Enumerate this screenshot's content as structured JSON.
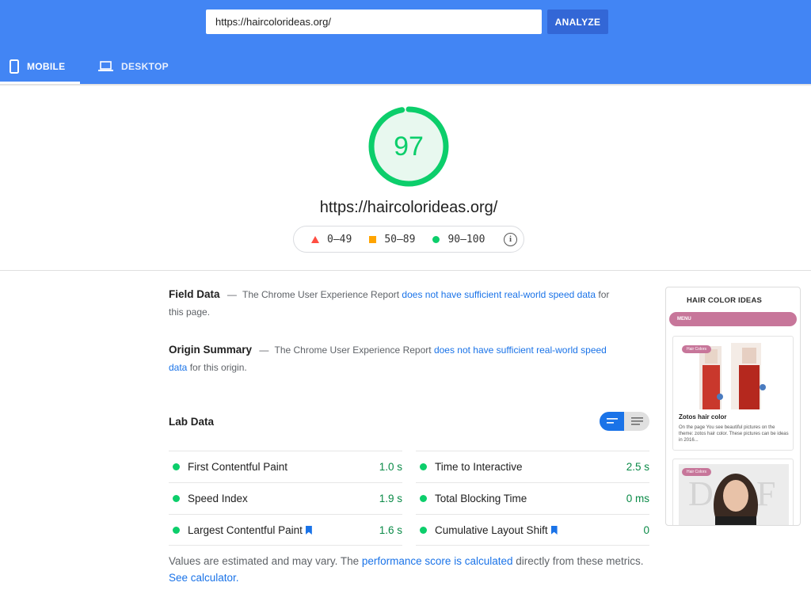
{
  "header": {
    "url_value": "https://haircolorideas.org/",
    "analyze_label": "ANALYZE",
    "tabs": [
      {
        "label": "MOBILE",
        "icon": "phone-icon",
        "selected": true
      },
      {
        "label": "DESKTOP",
        "icon": "laptop-icon",
        "selected": false
      }
    ],
    "colors": {
      "brand": "#4285f4",
      "button": "#3367d6"
    }
  },
  "summary": {
    "score": "97",
    "score_fraction": 0.97,
    "score_color": "#0cce6b",
    "url": "https://haircolorideas.org/",
    "legend": [
      {
        "range": "0–49",
        "icon": "red-triangle",
        "color": "#ff4e42"
      },
      {
        "range": "50–89",
        "icon": "orange-square",
        "color": "#ffa400"
      },
      {
        "range": "90–100",
        "icon": "green-circle",
        "color": "#0cce6b"
      }
    ],
    "info_icon": "info-icon"
  },
  "field_data": {
    "heading": "Field Data",
    "dash": "—",
    "text_before": "The Chrome User Experience Report",
    "link": "does not have sufficient real-world speed data",
    "text_after": "for this page."
  },
  "origin_summary": {
    "heading": "Origin Summary",
    "dash": "—",
    "text_before": "The Chrome User Experience Report",
    "link": "does not have sufficient real-world speed data",
    "text_after": "for this origin."
  },
  "lab_data": {
    "heading": "Lab Data",
    "metrics_left": [
      {
        "name": "First Contentful Paint",
        "value": "1.0 s",
        "bookmark": false
      },
      {
        "name": "Speed Index",
        "value": "1.9 s",
        "bookmark": false
      },
      {
        "name": "Largest Contentful Paint",
        "value": "1.6 s",
        "bookmark": true
      }
    ],
    "metrics_right": [
      {
        "name": "Time to Interactive",
        "value": "2.5 s",
        "bookmark": false
      },
      {
        "name": "Total Blocking Time",
        "value": "0 ms",
        "bookmark": false
      },
      {
        "name": "Cumulative Layout Shift",
        "value": "0",
        "bookmark": true
      }
    ],
    "note_before": "Values are estimated and may vary. The",
    "note_link": "performance score is calculated",
    "note_middle": "directly from these metrics.",
    "note_link2": "See calculator."
  },
  "preview": {
    "site_logo": "HAIR COLOR IDEAS",
    "menu_label": "MENU",
    "cards": [
      {
        "tag": "Hair Colors",
        "title": "Zotos hair color",
        "text": "On the page You see beautiful pictures on the theme: zotos hair color. These pictures can be ideas in 2016..."
      },
      {
        "tag": "Hair Colors",
        "title": "",
        "text": ""
      }
    ]
  }
}
